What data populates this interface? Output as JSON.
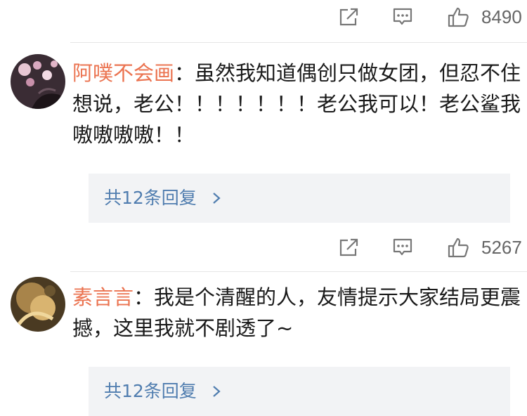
{
  "icons": {
    "share": "share-icon",
    "comment": "comment-icon",
    "like": "thumbs-up-icon",
    "chevron": "chevron-right-icon"
  },
  "colors": {
    "author": "#eb7350",
    "link": "#507daf",
    "meta": "#666666",
    "reply_bg": "#f2f3f5"
  },
  "threads": [
    {
      "like_count": "8490"
    },
    {
      "author": "阿噗不会画",
      "separator": "：",
      "text": "虽然我知道偶创只做女团，但忍不住想说，老公！！！！！！！老公我可以！老公鲨我嗷嗷嗷嗷！！",
      "reply_label": "共12条回复",
      "like_count": "5267"
    },
    {
      "author": "素言言",
      "separator": "：",
      "text": "我是个清醒的人，友情提示大家结局更震撼，这里我就不剧透了~",
      "reply_label": "共12条回复"
    }
  ]
}
